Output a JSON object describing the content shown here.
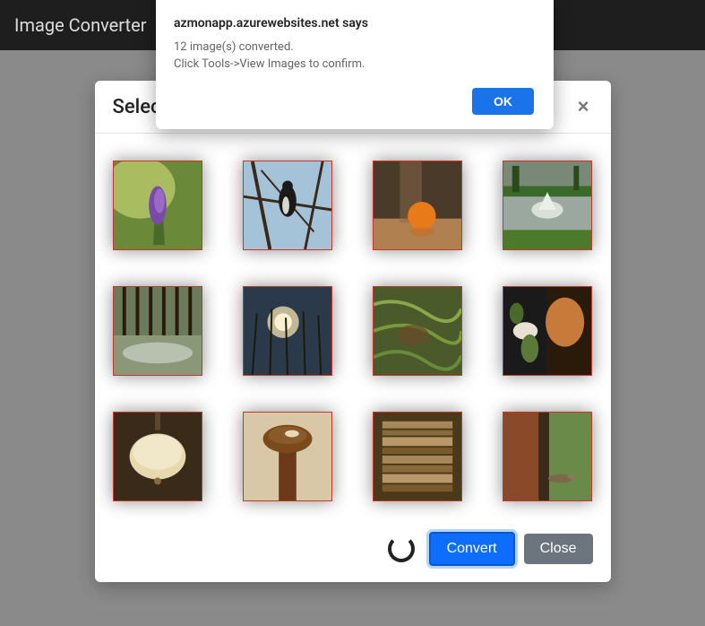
{
  "navbar": {
    "title": "Image Converter"
  },
  "modal": {
    "title": "Select Images to Convert",
    "close_x": "×",
    "convert_label": "Convert",
    "close_label": "Close",
    "thumbnails": [
      {
        "name": "thumb-plant-flower"
      },
      {
        "name": "thumb-bird-tree"
      },
      {
        "name": "thumb-orange-table"
      },
      {
        "name": "thumb-fountain-lawn"
      },
      {
        "name": "thumb-forest-stream"
      },
      {
        "name": "thumb-sunset-grass"
      },
      {
        "name": "thumb-leaves-ground"
      },
      {
        "name": "thumb-food-platter"
      },
      {
        "name": "thumb-lamp-ceiling"
      },
      {
        "name": "thumb-wood-handle"
      },
      {
        "name": "thumb-books-stack"
      },
      {
        "name": "thumb-lizard-wall"
      }
    ]
  },
  "alert": {
    "origin_text": "azmonapp.azurewebsites.net says",
    "message": "12 image(s) converted.\nClick Tools->View Images to confirm.",
    "ok_label": "OK"
  }
}
